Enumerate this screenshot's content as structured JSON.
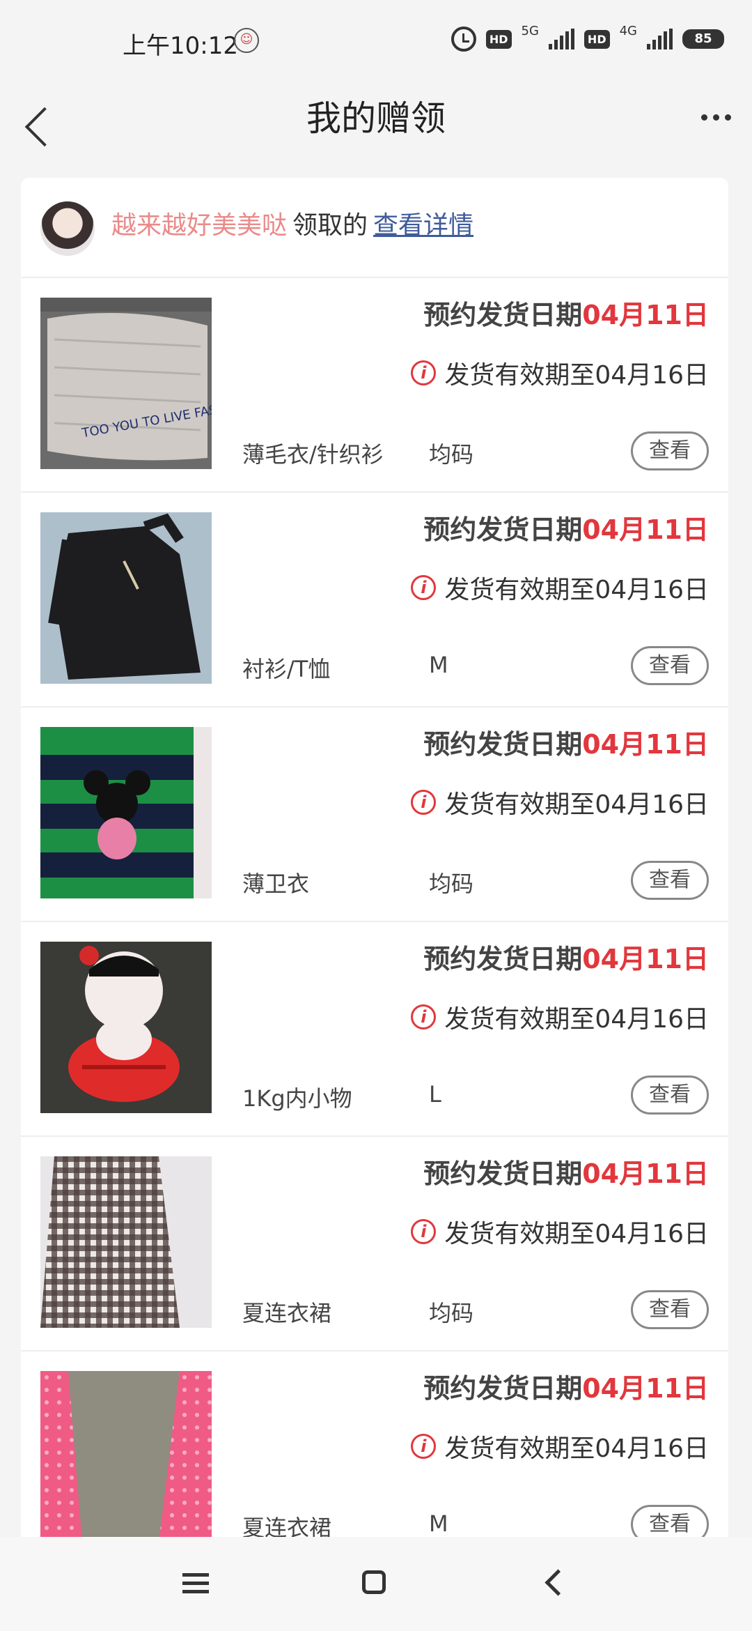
{
  "status_bar": {
    "time": "上午10:12",
    "hd1": "HD",
    "net1": "5G",
    "hd2": "HD",
    "net2": "4G",
    "battery": "85"
  },
  "header": {
    "title": "我的赠领"
  },
  "giver": {
    "name": "越来越好美美哒",
    "action": "领取的",
    "link": "查看详情"
  },
  "items": [
    {
      "date_label": "预约发货日期",
      "date": "04月11日",
      "valid": "发货有效期至04月16日",
      "category": "薄毛衣/针织衫",
      "size": "均码",
      "view": "查看"
    },
    {
      "date_label": "预约发货日期",
      "date": "04月11日",
      "valid": "发货有效期至04月16日",
      "category": "衬衫/T恤",
      "size": "M",
      "view": "查看"
    },
    {
      "date_label": "预约发货日期",
      "date": "04月11日",
      "valid": "发货有效期至04月16日",
      "category": "薄卫衣",
      "size": "均码",
      "view": "查看"
    },
    {
      "date_label": "预约发货日期",
      "date": "04月11日",
      "valid": "发货有效期至04月16日",
      "category": "1Kg内小物",
      "size": "L",
      "view": "查看"
    },
    {
      "date_label": "预约发货日期",
      "date": "04月11日",
      "valid": "发货有效期至04月16日",
      "category": "夏连衣裙",
      "size": "均码",
      "view": "查看"
    },
    {
      "date_label": "预约发货日期",
      "date": "04月11日",
      "valid": "发货有效期至04月16日",
      "category": "夏连衣裙",
      "size": "M",
      "view": "查看"
    }
  ],
  "colors": {
    "accent": "#e1373d",
    "link": "#3f5b9a",
    "giver_name": "#ea8a8a"
  }
}
